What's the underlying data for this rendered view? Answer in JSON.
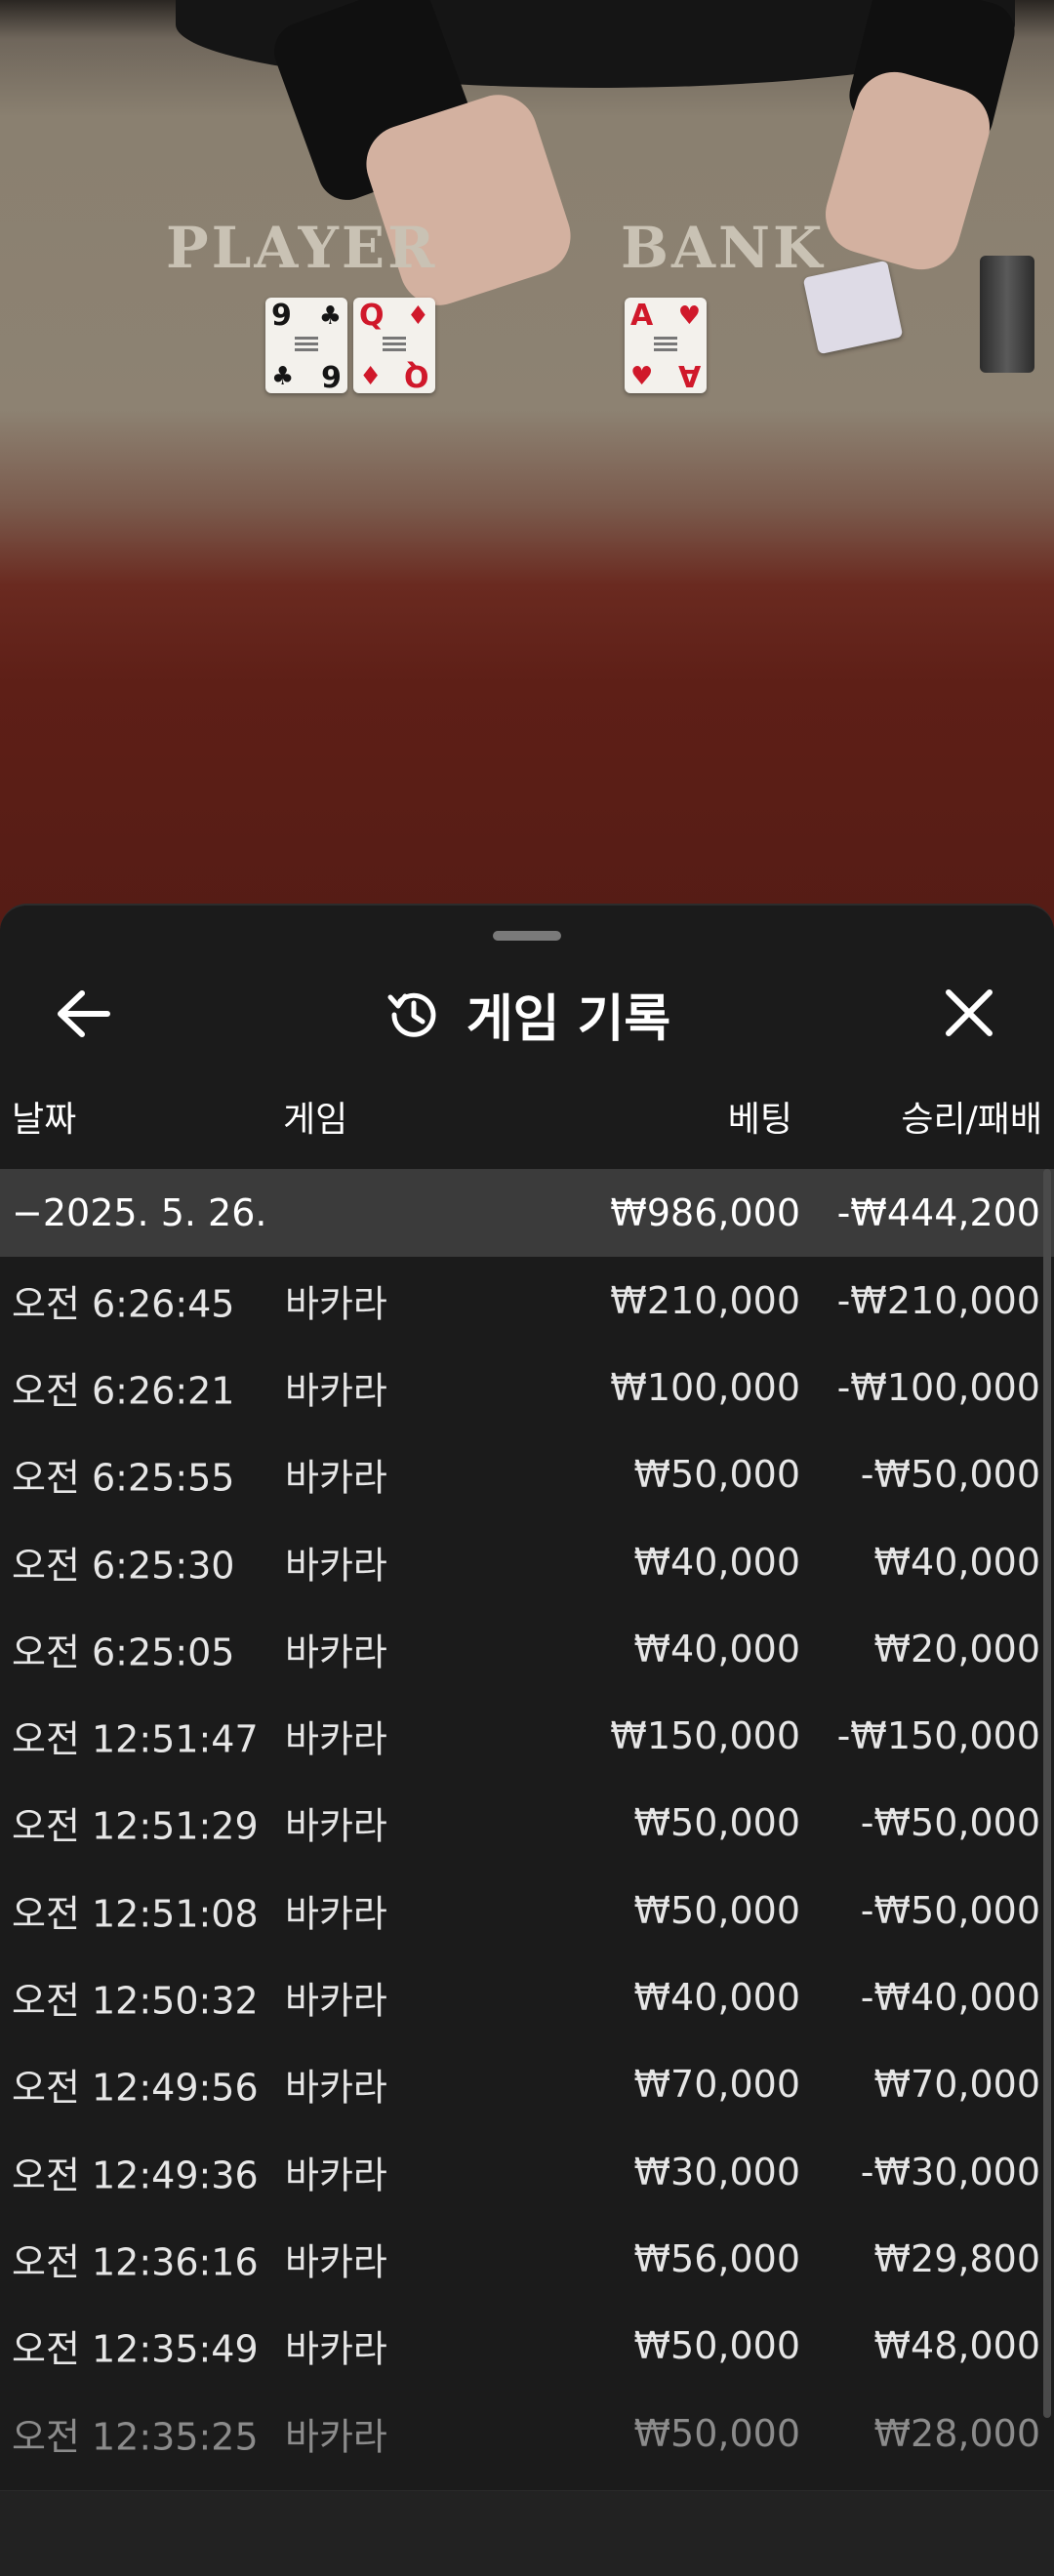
{
  "table": {
    "player_label": "PLAYER",
    "banker_label": "BANK",
    "player_cards": [
      {
        "rank": "9",
        "suit": "♣",
        "bottom": "6"
      },
      {
        "rank": "Q",
        "suit": "♦",
        "bottom": "Q"
      }
    ],
    "banker_cards": [
      {
        "rank": "A",
        "suit": "♥",
        "bottom": "A"
      }
    ]
  },
  "panel": {
    "title": "게임 기록",
    "back_icon": "arrow-left-icon",
    "history_icon": "history-icon",
    "close_icon": "close-icon"
  },
  "columns": {
    "date": "날짜",
    "game": "게임",
    "bet": "베팅",
    "result": "승리/패배"
  },
  "summary": {
    "date": "−2025. 5. 26.",
    "bet": "₩986,000",
    "result": "-₩444,200"
  },
  "rows": [
    {
      "time": "오전 6:26:45",
      "game": "바카라",
      "bet": "₩210,000",
      "result": "-₩210,000"
    },
    {
      "time": "오전 6:26:21",
      "game": "바카라",
      "bet": "₩100,000",
      "result": "-₩100,000"
    },
    {
      "time": "오전 6:25:55",
      "game": "바카라",
      "bet": "₩50,000",
      "result": "-₩50,000"
    },
    {
      "time": "오전 6:25:30",
      "game": "바카라",
      "bet": "₩40,000",
      "result": "₩40,000"
    },
    {
      "time": "오전 6:25:05",
      "game": "바카라",
      "bet": "₩40,000",
      "result": "₩20,000"
    },
    {
      "time": "오전 12:51:47",
      "game": "바카라",
      "bet": "₩150,000",
      "result": "-₩150,000"
    },
    {
      "time": "오전 12:51:29",
      "game": "바카라",
      "bet": "₩50,000",
      "result": "-₩50,000"
    },
    {
      "time": "오전 12:51:08",
      "game": "바카라",
      "bet": "₩50,000",
      "result": "-₩50,000"
    },
    {
      "time": "오전 12:50:32",
      "game": "바카라",
      "bet": "₩40,000",
      "result": "-₩40,000"
    },
    {
      "time": "오전 12:49:56",
      "game": "바카라",
      "bet": "₩70,000",
      "result": "₩70,000"
    },
    {
      "time": "오전 12:49:36",
      "game": "바카라",
      "bet": "₩30,000",
      "result": "-₩30,000"
    },
    {
      "time": "오전 12:36:16",
      "game": "바카라",
      "bet": "₩56,000",
      "result": "₩29,800"
    },
    {
      "time": "오전 12:35:49",
      "game": "바카라",
      "bet": "₩50,000",
      "result": "₩48,000"
    },
    {
      "time": "오전 12:35:25",
      "game": "바카라",
      "bet": "₩50,000",
      "result": "₩28,000"
    }
  ]
}
